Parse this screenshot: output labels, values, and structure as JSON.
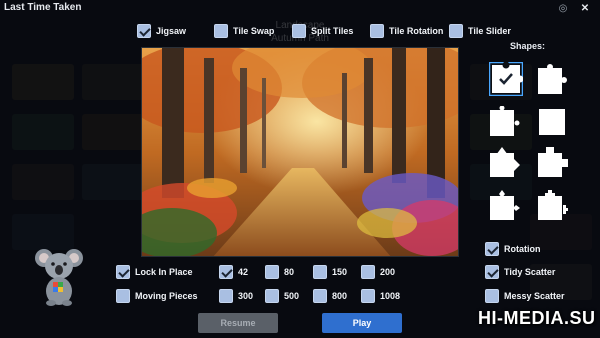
{
  "header": {
    "title": "Last Time Taken",
    "ghost_line1": "Landscape",
    "ghost_line2": "Autumn Path"
  },
  "modes": [
    {
      "label": "Jigsaw",
      "checked": true
    },
    {
      "label": "Tile Swap",
      "checked": false
    },
    {
      "label": "Split Tiles",
      "checked": false
    },
    {
      "label": "Tile Rotation",
      "checked": false
    },
    {
      "label": "Tile Slider",
      "checked": false
    }
  ],
  "shapes": {
    "label": "Shapes:",
    "selected_index": 0
  },
  "options_right": [
    {
      "label": "Rotation",
      "checked": true
    },
    {
      "label": "Tidy Scatter",
      "checked": true
    },
    {
      "label": "Messy Scatter",
      "checked": false
    }
  ],
  "options_left": [
    {
      "label": "Lock In Place",
      "checked": true
    },
    {
      "label": "Moving Pieces",
      "checked": false
    }
  ],
  "piece_counts": [
    {
      "label": "42",
      "checked": true
    },
    {
      "label": "80",
      "checked": false
    },
    {
      "label": "150",
      "checked": false
    },
    {
      "label": "200",
      "checked": false
    },
    {
      "label": "300",
      "checked": false
    },
    {
      "label": "500",
      "checked": false
    },
    {
      "label": "800",
      "checked": false
    },
    {
      "label": "1008",
      "checked": false
    }
  ],
  "buttons": {
    "resume": "Resume",
    "play": "Play"
  },
  "watermark": "HI-MEDIA.SU",
  "colors": {
    "play": "#2f6fcf",
    "resume_disabled": "#5a6068",
    "checkbox": "#a9bfe2"
  }
}
